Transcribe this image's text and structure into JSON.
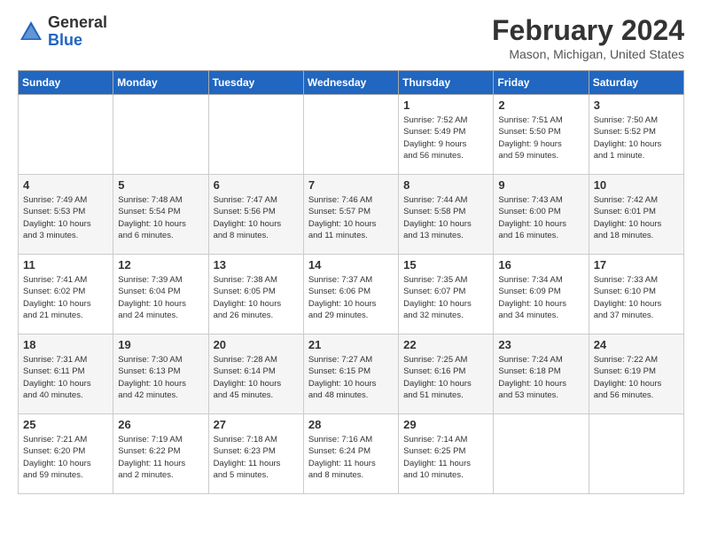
{
  "header": {
    "logo_general": "General",
    "logo_blue": "Blue",
    "month_year": "February 2024",
    "location": "Mason, Michigan, United States"
  },
  "days_of_week": [
    "Sunday",
    "Monday",
    "Tuesday",
    "Wednesday",
    "Thursday",
    "Friday",
    "Saturday"
  ],
  "weeks": [
    [
      {
        "day": "",
        "info": ""
      },
      {
        "day": "",
        "info": ""
      },
      {
        "day": "",
        "info": ""
      },
      {
        "day": "",
        "info": ""
      },
      {
        "day": "1",
        "info": "Sunrise: 7:52 AM\nSunset: 5:49 PM\nDaylight: 9 hours\nand 56 minutes."
      },
      {
        "day": "2",
        "info": "Sunrise: 7:51 AM\nSunset: 5:50 PM\nDaylight: 9 hours\nand 59 minutes."
      },
      {
        "day": "3",
        "info": "Sunrise: 7:50 AM\nSunset: 5:52 PM\nDaylight: 10 hours\nand 1 minute."
      }
    ],
    [
      {
        "day": "4",
        "info": "Sunrise: 7:49 AM\nSunset: 5:53 PM\nDaylight: 10 hours\nand 3 minutes."
      },
      {
        "day": "5",
        "info": "Sunrise: 7:48 AM\nSunset: 5:54 PM\nDaylight: 10 hours\nand 6 minutes."
      },
      {
        "day": "6",
        "info": "Sunrise: 7:47 AM\nSunset: 5:56 PM\nDaylight: 10 hours\nand 8 minutes."
      },
      {
        "day": "7",
        "info": "Sunrise: 7:46 AM\nSunset: 5:57 PM\nDaylight: 10 hours\nand 11 minutes."
      },
      {
        "day": "8",
        "info": "Sunrise: 7:44 AM\nSunset: 5:58 PM\nDaylight: 10 hours\nand 13 minutes."
      },
      {
        "day": "9",
        "info": "Sunrise: 7:43 AM\nSunset: 6:00 PM\nDaylight: 10 hours\nand 16 minutes."
      },
      {
        "day": "10",
        "info": "Sunrise: 7:42 AM\nSunset: 6:01 PM\nDaylight: 10 hours\nand 18 minutes."
      }
    ],
    [
      {
        "day": "11",
        "info": "Sunrise: 7:41 AM\nSunset: 6:02 PM\nDaylight: 10 hours\nand 21 minutes."
      },
      {
        "day": "12",
        "info": "Sunrise: 7:39 AM\nSunset: 6:04 PM\nDaylight: 10 hours\nand 24 minutes."
      },
      {
        "day": "13",
        "info": "Sunrise: 7:38 AM\nSunset: 6:05 PM\nDaylight: 10 hours\nand 26 minutes."
      },
      {
        "day": "14",
        "info": "Sunrise: 7:37 AM\nSunset: 6:06 PM\nDaylight: 10 hours\nand 29 minutes."
      },
      {
        "day": "15",
        "info": "Sunrise: 7:35 AM\nSunset: 6:07 PM\nDaylight: 10 hours\nand 32 minutes."
      },
      {
        "day": "16",
        "info": "Sunrise: 7:34 AM\nSunset: 6:09 PM\nDaylight: 10 hours\nand 34 minutes."
      },
      {
        "day": "17",
        "info": "Sunrise: 7:33 AM\nSunset: 6:10 PM\nDaylight: 10 hours\nand 37 minutes."
      }
    ],
    [
      {
        "day": "18",
        "info": "Sunrise: 7:31 AM\nSunset: 6:11 PM\nDaylight: 10 hours\nand 40 minutes."
      },
      {
        "day": "19",
        "info": "Sunrise: 7:30 AM\nSunset: 6:13 PM\nDaylight: 10 hours\nand 42 minutes."
      },
      {
        "day": "20",
        "info": "Sunrise: 7:28 AM\nSunset: 6:14 PM\nDaylight: 10 hours\nand 45 minutes."
      },
      {
        "day": "21",
        "info": "Sunrise: 7:27 AM\nSunset: 6:15 PM\nDaylight: 10 hours\nand 48 minutes."
      },
      {
        "day": "22",
        "info": "Sunrise: 7:25 AM\nSunset: 6:16 PM\nDaylight: 10 hours\nand 51 minutes."
      },
      {
        "day": "23",
        "info": "Sunrise: 7:24 AM\nSunset: 6:18 PM\nDaylight: 10 hours\nand 53 minutes."
      },
      {
        "day": "24",
        "info": "Sunrise: 7:22 AM\nSunset: 6:19 PM\nDaylight: 10 hours\nand 56 minutes."
      }
    ],
    [
      {
        "day": "25",
        "info": "Sunrise: 7:21 AM\nSunset: 6:20 PM\nDaylight: 10 hours\nand 59 minutes."
      },
      {
        "day": "26",
        "info": "Sunrise: 7:19 AM\nSunset: 6:22 PM\nDaylight: 11 hours\nand 2 minutes."
      },
      {
        "day": "27",
        "info": "Sunrise: 7:18 AM\nSunset: 6:23 PM\nDaylight: 11 hours\nand 5 minutes."
      },
      {
        "day": "28",
        "info": "Sunrise: 7:16 AM\nSunset: 6:24 PM\nDaylight: 11 hours\nand 8 minutes."
      },
      {
        "day": "29",
        "info": "Sunrise: 7:14 AM\nSunset: 6:25 PM\nDaylight: 11 hours\nand 10 minutes."
      },
      {
        "day": "",
        "info": ""
      },
      {
        "day": "",
        "info": ""
      }
    ]
  ]
}
